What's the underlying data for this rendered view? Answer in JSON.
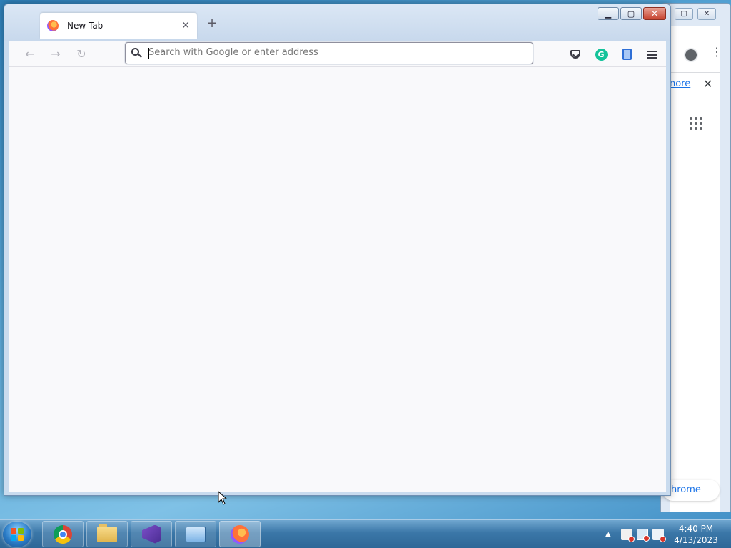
{
  "firefox": {
    "tab_title": "New Tab",
    "new_tab_symbol": "+",
    "url_placeholder": "Search with Google or enter address",
    "nav": {
      "back": "←",
      "forward": "→",
      "reload": "↻"
    },
    "controls": {
      "minimize": "▁",
      "maximize": "▢",
      "close": "✕"
    }
  },
  "chrome_background": {
    "controls": {
      "maximize": "▢",
      "close": "✕"
    },
    "kebab": "⋮",
    "banner_link": "nore",
    "banner_close": "✕",
    "customize_label": "hrome"
  },
  "taskbar": {
    "tray_arrow": "▲",
    "time": "4:40 PM",
    "date": "4/13/2023",
    "apps": [
      "chrome",
      "file-explorer",
      "visual-studio-installer",
      "remote-desktop",
      "firefox"
    ]
  },
  "colors": {
    "firefox_accent": "#9059ff",
    "grammarly": "#15c39a",
    "close_button": "#c7432f"
  }
}
